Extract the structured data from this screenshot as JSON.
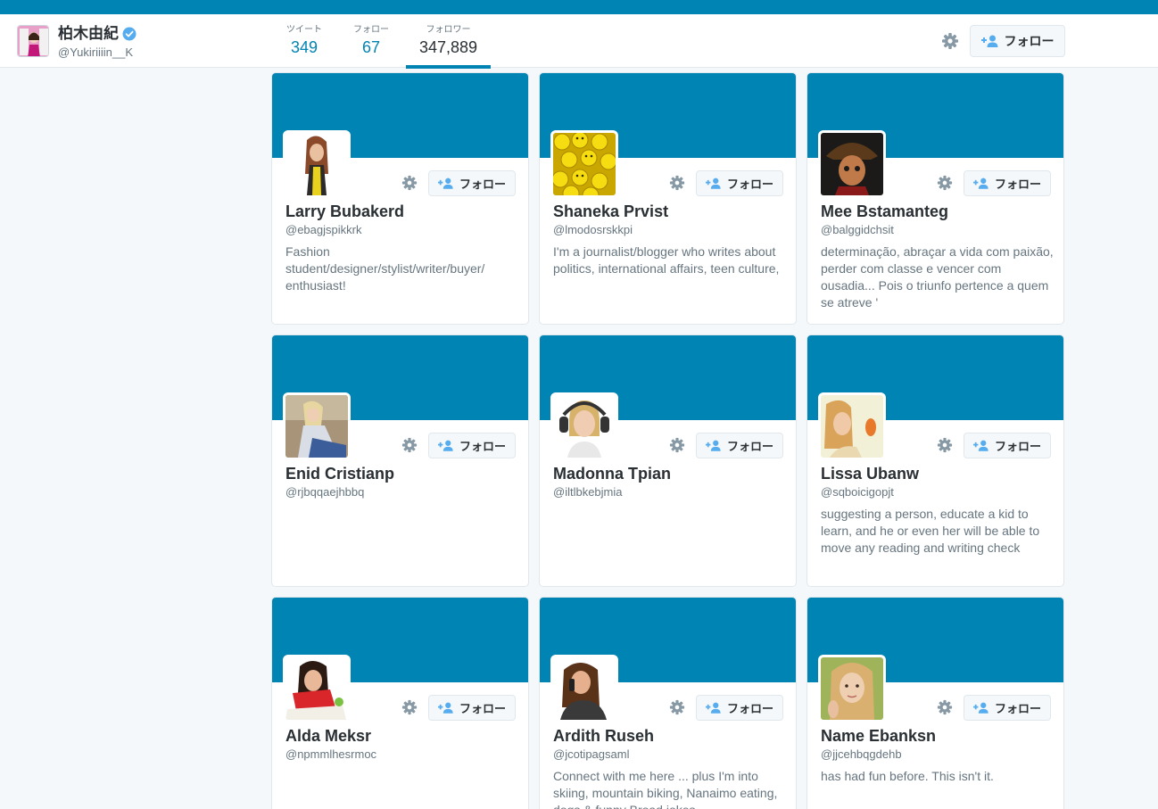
{
  "profile": {
    "name": "柏木由紀",
    "handle": "@Yukiriiiin__K"
  },
  "stats": [
    {
      "label": "ツイート",
      "value": "349"
    },
    {
      "label": "フォロー",
      "value": "67"
    },
    {
      "label": "フォロワー",
      "value": "347,889"
    }
  ],
  "active_tab": "フォロワー",
  "follow_label": "フォロー",
  "colors": {
    "brand": "#0084b4",
    "verified": "#55acee",
    "follow_icon": "#55acee"
  },
  "icons": {
    "settings": "gear-icon",
    "follow": "person-plus-icon",
    "verified": "verified-badge-icon"
  },
  "users": [
    {
      "name": "Larry Bubakerd",
      "handle": "@ebagjspikkrk",
      "bio": "Fashion student/designer/stylist/writer/buyer/ enthusiast!"
    },
    {
      "name": "Shaneka Prvist",
      "handle": "@lmodosrskkpi",
      "bio": "I'm a journalist/blogger who writes about politics, international affairs, teen culture,"
    },
    {
      "name": "Mee Bstamanteg",
      "handle": "@balggidchsit",
      "bio": "determinação, abraçar a vida com paixão, perder com classe e vencer com ousadia... Pois o triunfo pertence a quem se atreve '"
    },
    {
      "name": "Enid Cristianp",
      "handle": "@rjbqqaejhbbq",
      "bio": ""
    },
    {
      "name": "Madonna Tpian",
      "handle": "@iltlbkebjmia",
      "bio": ""
    },
    {
      "name": "Lissa Ubanw",
      "handle": "@sqboicigopjt",
      "bio": "suggesting a person, educate a kid to learn, and he or even her will be able to move any reading and writing check"
    },
    {
      "name": "Alda Meksr",
      "handle": "@npmmlhesrmoc",
      "bio": ""
    },
    {
      "name": "Ardith Ruseh",
      "handle": "@jcotipagsaml",
      "bio": "Connect with me here ... plus I'm into skiing, mountain biking, Nanaimo eating, dogs & funny Broad jokes"
    },
    {
      "name": "Name Ebanksn",
      "handle": "@jjcehbqgdehb",
      "bio": "has had fun before. This isn't it."
    }
  ]
}
